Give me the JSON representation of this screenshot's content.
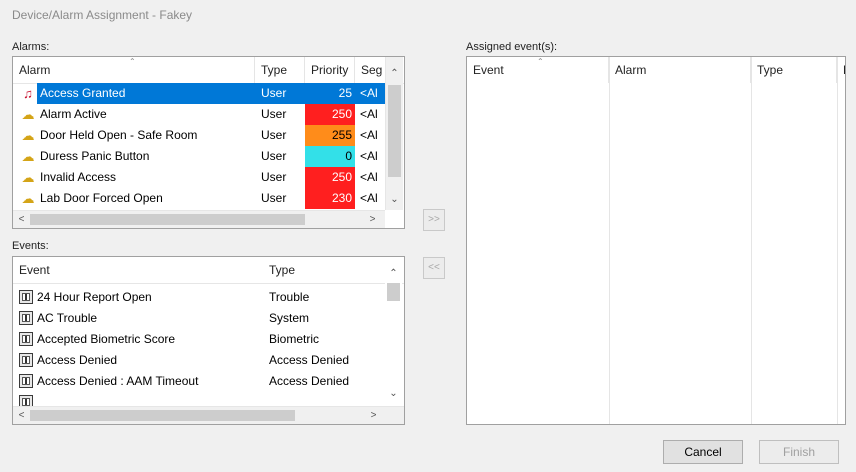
{
  "window": {
    "title": "Device/Alarm Assignment - Fakey"
  },
  "alarms": {
    "label": "Alarms:",
    "columns": {
      "alarm": "Alarm",
      "type": "Type",
      "priority": "Priority",
      "segment": "Seg"
    },
    "rows": [
      {
        "name": "Access Granted",
        "type": "User",
        "priority": "25",
        "priority_color": "#0078d7",
        "seg": "<Al",
        "selected": true,
        "icon": "red-guitar-icon"
      },
      {
        "name": "Alarm Active",
        "type": "User",
        "priority": "250",
        "priority_color": "#ff1f1f",
        "seg": "<Al",
        "icon": "bell-icon"
      },
      {
        "name": "Door Held Open - Safe Room",
        "type": "User",
        "priority": "255",
        "priority_color": "#ff8c1a",
        "seg": "<Al",
        "icon": "bell-icon"
      },
      {
        "name": "Duress Panic Button",
        "type": "User",
        "priority": "0",
        "priority_color": "#33e0e8",
        "seg": "<Al",
        "icon": "bell-icon"
      },
      {
        "name": "Invalid Access",
        "type": "User",
        "priority": "250",
        "priority_color": "#ff1f1f",
        "seg": "<Al",
        "icon": "bell-icon"
      },
      {
        "name": "Lab Door Forced Open",
        "type": "User",
        "priority": "230",
        "priority_color": "#ff1f1f",
        "seg": "<Al",
        "icon": "bell-icon"
      }
    ]
  },
  "events": {
    "label": "Events:",
    "columns": {
      "event": "Event",
      "type": "Type"
    },
    "rows": [
      {
        "name": "24 Hour Report Open",
        "type": "Trouble"
      },
      {
        "name": "AC Trouble",
        "type": "System"
      },
      {
        "name": "Accepted Biometric Score",
        "type": "Biometric"
      },
      {
        "name": "Access Denied",
        "type": "Access Denied"
      },
      {
        "name": "Access Denied : AAM Timeout",
        "type": "Access Denied"
      },
      {
        "name": "",
        "type": ""
      }
    ]
  },
  "assigned": {
    "label": "Assigned event(s):",
    "columns": {
      "event": "Event",
      "alarm": "Alarm",
      "type": "Type",
      "priority": "Pa"
    }
  },
  "buttons": {
    "add": ">>",
    "remove": "<<",
    "cancel": "Cancel",
    "finish": "Finish"
  }
}
